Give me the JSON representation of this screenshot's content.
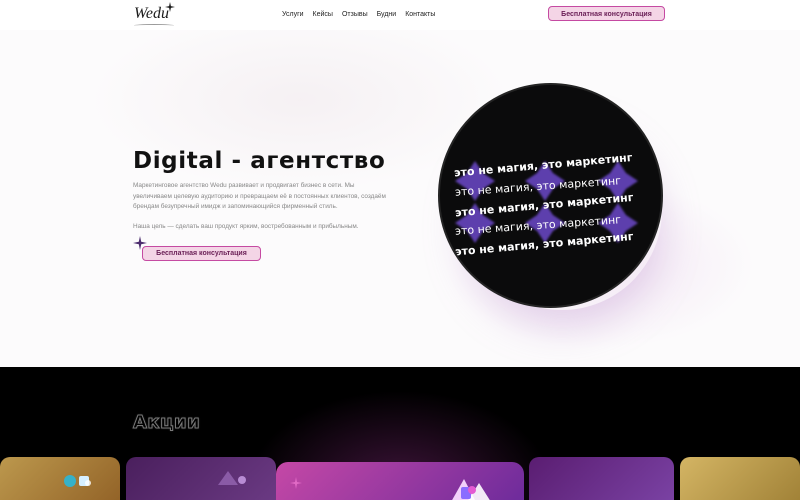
{
  "header": {
    "logo_text": "Wedu",
    "nav": [
      {
        "label": "Услуги"
      },
      {
        "label": "Кейсы"
      },
      {
        "label": "Отзывы"
      },
      {
        "label": "Будни"
      },
      {
        "label": "Контакты"
      }
    ],
    "cta_label": "Бесплатная консультация"
  },
  "hero": {
    "title": "Digital - агентство",
    "description": "Маркетинговое агентство Wedu развивает и продвигает бизнес в сети. Мы увеличиваем целевую аудиторию и превращаем её в постоянных клиентов, создаём брендам безупречный имидж и запоминающийся фирменный стиль.",
    "goal": "Наша цель — сделать ваш продукт ярким, востребованным и прибыльным.",
    "cta_label": "Бесплатная консультация",
    "circle_text": "это не магия, это маркетинг"
  },
  "promo": {
    "title": "Акции"
  },
  "colors": {
    "accent": "#c54aa2",
    "accent_light": "#f4d5e6",
    "dark_bg": "#000000",
    "circle_bg": "#0b0b0c"
  }
}
